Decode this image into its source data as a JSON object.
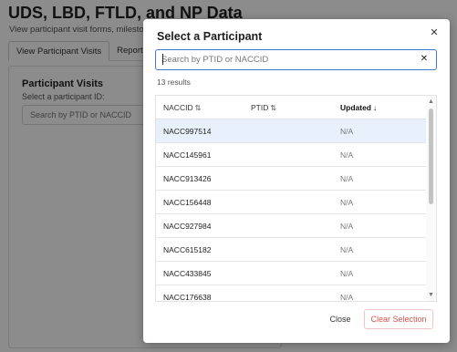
{
  "background": {
    "title": "UDS, LBD, FTLD, and NP Data",
    "subtitle": "View participant visit forms, milestone",
    "tabs": [
      {
        "label": "View Participant Visits",
        "active": true
      },
      {
        "label": "Reports",
        "active": false
      }
    ],
    "card": {
      "title": "Participant Visits",
      "label": "Select a participant ID:",
      "input_placeholder": "Search by PTID or NACCID"
    }
  },
  "modal": {
    "title": "Select a Participant",
    "search": {
      "value": "",
      "placeholder": "Search by PTID or NACCID"
    },
    "results_count": "13 results",
    "table": {
      "columns": [
        {
          "label": "NACCID",
          "sort_icon": "⇅",
          "sorted": false
        },
        {
          "label": "PTID",
          "sort_icon": "⇅",
          "sorted": false
        },
        {
          "label": "Updated",
          "sort_icon": "↓",
          "sorted": true
        }
      ],
      "rows": [
        {
          "naccid": "NACC997514",
          "ptid": "",
          "updated": "N/A"
        },
        {
          "naccid": "NACC145961",
          "ptid": "",
          "updated": "N/A"
        },
        {
          "naccid": "NACC913426",
          "ptid": "",
          "updated": "N/A"
        },
        {
          "naccid": "NACC156448",
          "ptid": "",
          "updated": "N/A"
        },
        {
          "naccid": "NACC927984",
          "ptid": "",
          "updated": "N/A"
        },
        {
          "naccid": "NACC615182",
          "ptid": "",
          "updated": "N/A"
        },
        {
          "naccid": "NACC433845",
          "ptid": "",
          "updated": "N/A"
        },
        {
          "naccid": "NACC176638",
          "ptid": "",
          "updated": "N/A"
        }
      ]
    },
    "close_label": "Close",
    "clear_label": "Clear Selection"
  },
  "icons": {
    "close": "close-icon",
    "clear": "clear-search-icon",
    "sort": "sort-icon",
    "sort_desc": "sort-descending-icon"
  },
  "colors": {
    "accent": "#3f7bd6",
    "row_highlight": "#e8f1fb",
    "danger": "#d9534f"
  }
}
